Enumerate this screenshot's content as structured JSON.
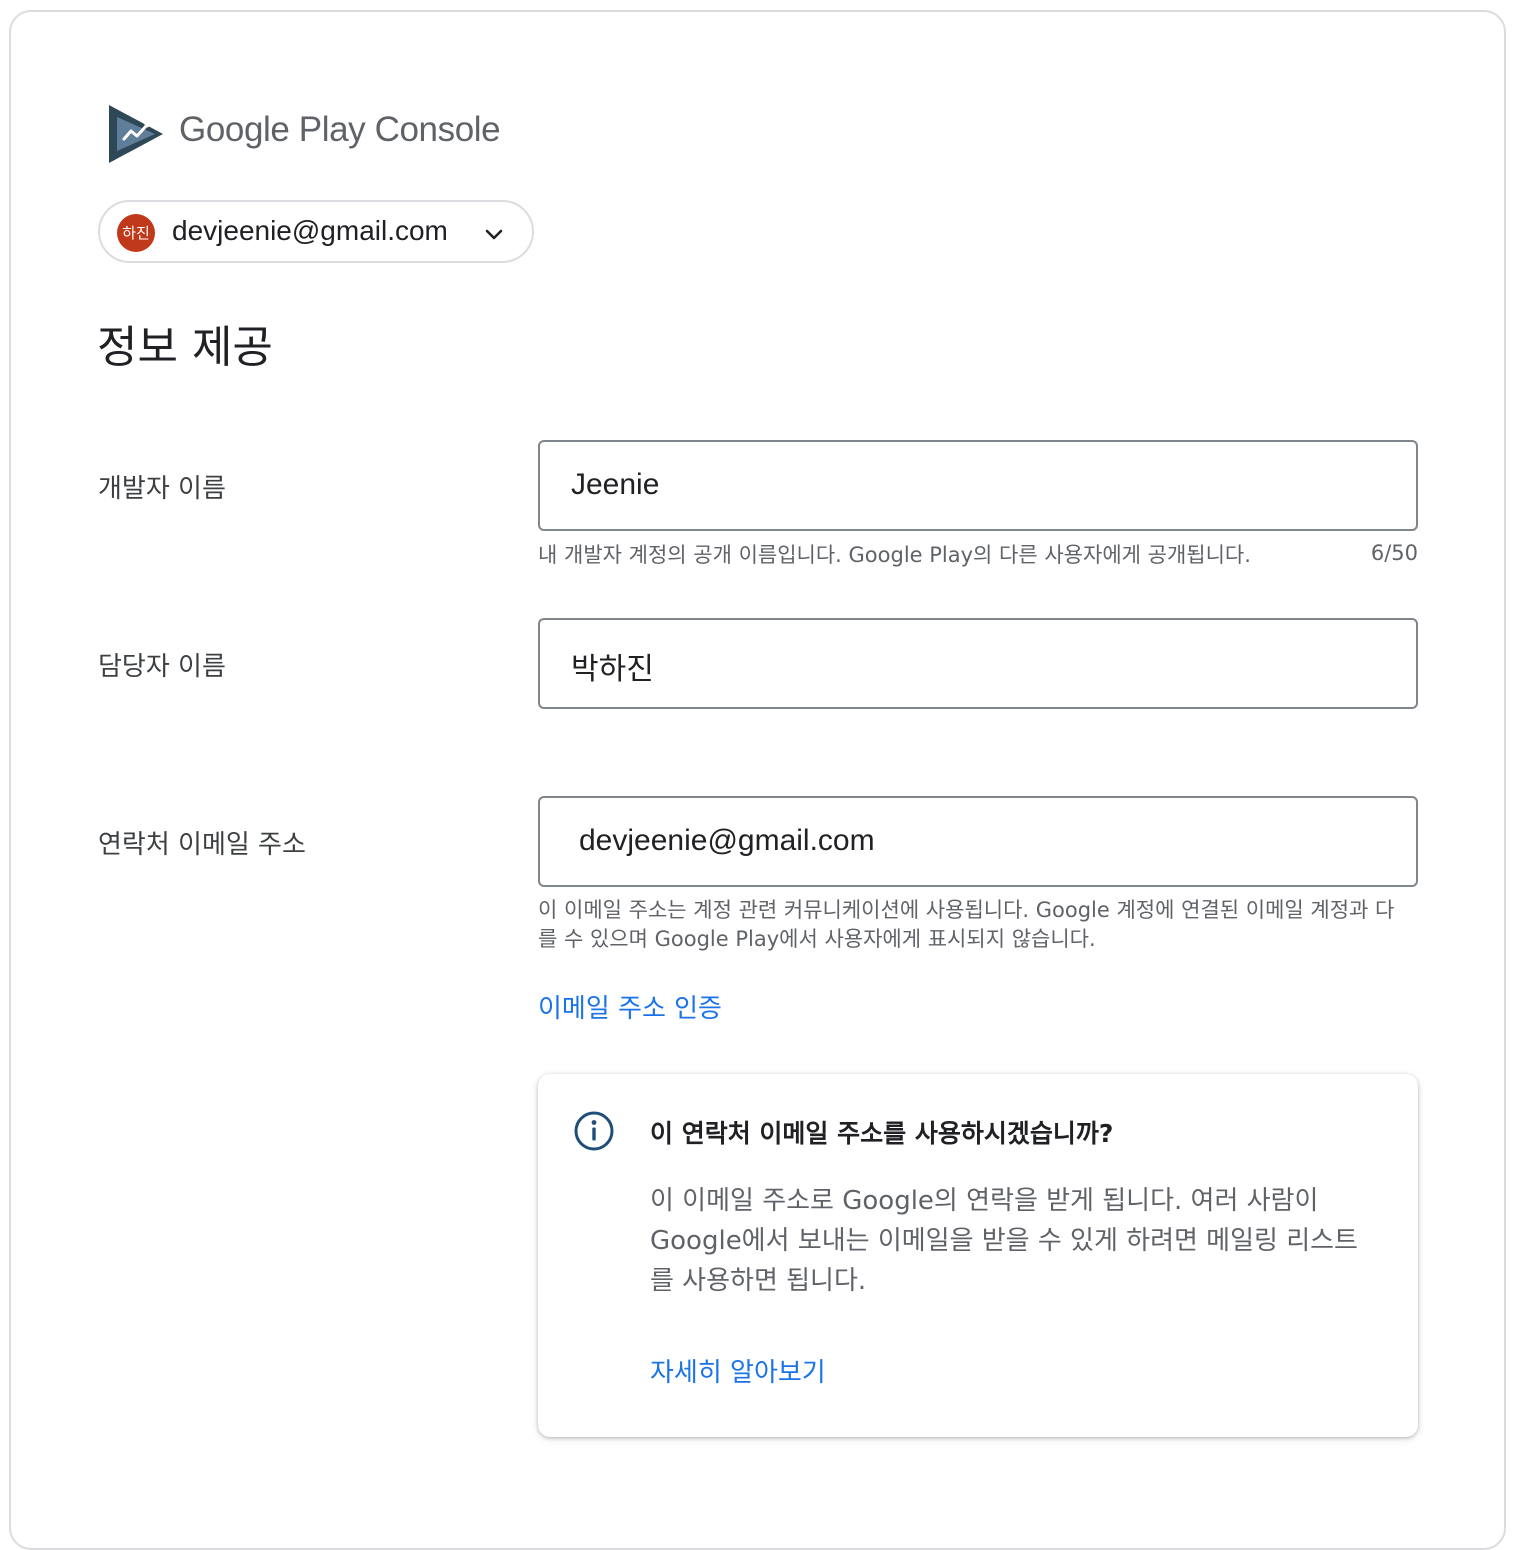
{
  "header": {
    "brand_google_play": "Google Play",
    "brand_console": "Console",
    "logo_icon": "play-console-logo-icon"
  },
  "account": {
    "avatar_text": "하진",
    "avatar_color": "#c0391b",
    "email": "devjeenie@gmail.com",
    "dropdown_icon": "chevron-down-icon"
  },
  "page": {
    "title": "정보 제공"
  },
  "form": {
    "developer_name": {
      "label": "개발자 이름",
      "value": "Jeenie",
      "helper": "내 개발자 계정의 공개 이름입니다. Google Play의 다른 사용자에게 공개됩니다.",
      "counter": "6/50"
    },
    "contact_name": {
      "label": "담당자 이름",
      "value": "박하진"
    },
    "contact_email": {
      "label": "연락처 이메일 주소",
      "value": "devjeenie@gmail.com",
      "helper": "이 이메일 주소는 계정 관련 커뮤니케이션에 사용됩니다. Google 계정에 연결된 이메일 계정과 다를 수 있으며 Google Play에서 사용자에게 표시되지 않습니다.",
      "verify_link": "이메일 주소 인증"
    }
  },
  "info_card": {
    "icon": "info-icon",
    "title": "이 연락처 이메일 주소를 사용하시겠습니까?",
    "body": "이 이메일 주소로 Google의 연락을 받게 됩니다. 여러 사람이 Google에서 보내는 이메일을 받을 수 있게 하려면 메일링 리스트를 사용하면 됩니다.",
    "learn_more": "자세히 알아보기"
  },
  "colors": {
    "link": "#1a73e8",
    "border": "#dadce0",
    "input_border": "#80868b",
    "info_icon": "#1f4e79"
  }
}
